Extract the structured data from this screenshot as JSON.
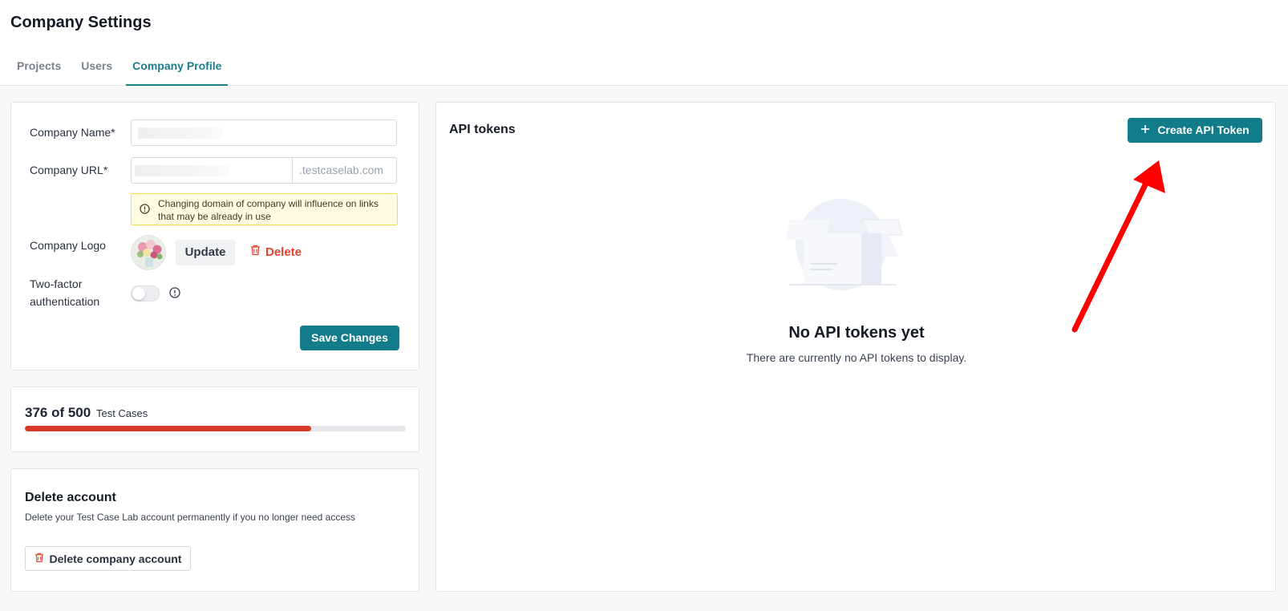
{
  "page": {
    "title": "Company Settings"
  },
  "tabs": [
    {
      "label": "Projects",
      "active": false
    },
    {
      "label": "Users",
      "active": false
    },
    {
      "label": "Company Profile",
      "active": true
    }
  ],
  "profile": {
    "company_name_label": "Company Name*",
    "company_url_label": "Company URL*",
    "url_suffix": ".testcaselab.com",
    "domain_warning": "Changing domain of company will influence on links that may be already in use",
    "logo_label": "Company Logo",
    "update_label": "Update",
    "delete_label": "Delete",
    "two_factor_label": "Two-factor authentication",
    "two_factor_enabled": false,
    "save_label": "Save Changes"
  },
  "usage": {
    "summary": "376 of 500",
    "unit": "Test Cases",
    "used": 376,
    "limit": 500,
    "fill_color": "#d83a2a"
  },
  "delete_account": {
    "title": "Delete account",
    "description": "Delete your Test Case Lab account permanently if you no longer need access",
    "button_label": "Delete company account"
  },
  "api_tokens": {
    "title": "API tokens",
    "create_label": "Create API Token",
    "empty_title": "No API tokens yet",
    "empty_description": "There are currently no API tokens to display."
  },
  "colors": {
    "accent": "#127c8a",
    "danger": "#e5412f",
    "warning_bg": "#fffbe0",
    "annotation_arrow": "#ff0000"
  },
  "icons": {
    "warning": "alert-circle-icon",
    "trash": "trash-icon",
    "info": "info-circle-icon",
    "plus": "plus-icon"
  }
}
